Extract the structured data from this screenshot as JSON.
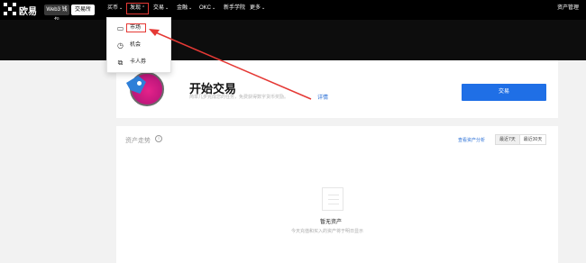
{
  "brand": {
    "logo_text": "欧易"
  },
  "topbar": {
    "seg_web3": "Web3 钱包",
    "seg_exchange": "交易所",
    "nav": [
      {
        "label": "买币"
      },
      {
        "label": "发现"
      },
      {
        "label": "交易"
      },
      {
        "label": "金融"
      },
      {
        "label": "OKC"
      },
      {
        "label": "新手学院"
      },
      {
        "label": "更多"
      }
    ],
    "right_label": "资产管理"
  },
  "dropdown": {
    "items": [
      {
        "label": "市场",
        "icon": "market-icon"
      },
      {
        "label": "机会",
        "icon": "opportunity-icon"
      },
      {
        "label": "卡人券",
        "icon": "coupon-icon"
      }
    ]
  },
  "start_card": {
    "title": "开始交易",
    "subtitle": "简单几步完成您的任务，免费获得数字货币奖励。",
    "link": "详情",
    "button": "交易"
  },
  "assets_card": {
    "title": "资产走势",
    "info_glyph": "i",
    "link": "查看资产分析",
    "ranges": [
      "最近7天",
      "最近30天"
    ],
    "empty_title": "暂无资产",
    "empty_sub": "今天充值和买入的资产将于明日显示"
  },
  "colors": {
    "accent": "#1f6fe6",
    "annotation": "#e53935",
    "banner": "#0d0d0d"
  }
}
